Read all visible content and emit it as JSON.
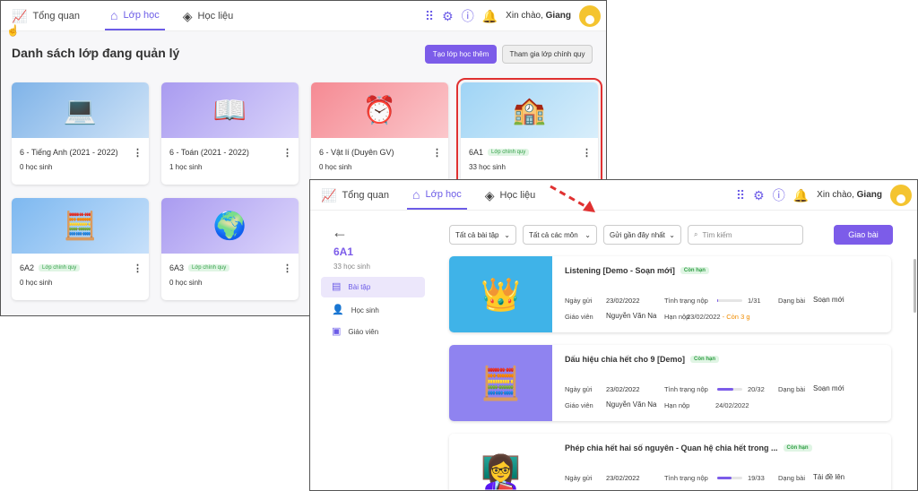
{
  "win1": {
    "nav": {
      "tabs": [
        "Tổng quan",
        "Lớp học",
        "Học liệu"
      ],
      "greeting": "Xin chào,",
      "user": "Giang"
    },
    "heading": "Danh sách lớp đang quản lý",
    "btn_create": "Tạo lớp học thêm",
    "btn_join": "Tham gia lớp chính quy",
    "classes": [
      {
        "title": "6 - Tiếng Anh (2021 - 2022)",
        "students": "0 học sinh",
        "badge": "",
        "icon": "classroom-online-icon"
      },
      {
        "title": "6 - Toán (2021 - 2022)",
        "students": "1 học sinh",
        "badge": "",
        "icon": "laptop-book-icon"
      },
      {
        "title": "6 - Vật lí (Duyên GV)",
        "students": "0 học sinh",
        "badge": "",
        "icon": "alarm-clock-icon"
      },
      {
        "title": "6A1",
        "students": "33 học sinh",
        "badge": "Lớp chính quy",
        "icon": "classroom-board-icon"
      },
      {
        "title": "6A2",
        "students": "0 học sinh",
        "badge": "Lớp chính quy",
        "icon": "calculator-icon"
      },
      {
        "title": "6A3",
        "students": "0 học sinh",
        "badge": "Lớp chính quy",
        "icon": "globe-books-icon"
      }
    ]
  },
  "win2": {
    "nav": {
      "tabs": [
        "Tổng quan",
        "Lớp học",
        "Học liệu"
      ],
      "greeting": "Xin chào,",
      "user": "Giang"
    },
    "class_name": "6A1",
    "class_count": "33 học sinh",
    "side": [
      "Bài tập",
      "Học sinh",
      "Giáo viên"
    ],
    "filters": [
      "Tất cả bài tập",
      "Tất cả các môn",
      "Gửi gần đây nhất"
    ],
    "search_placeholder": "Tìm kiếm",
    "assign_btn": "Giao bài",
    "labels": {
      "sent": "Ngày gửi",
      "teacher": "Giáo viên",
      "status": "Tình trạng nộp",
      "due": "Hạn nộp",
      "type": "Dạng bài"
    },
    "assignments": [
      {
        "title": "Listening [Demo - Soạn mới]",
        "badge": "Còn hạn",
        "sent": "23/02/2022",
        "teacher": "Nguyễn Văn Na",
        "submitted": "1/31",
        "progress": 0.03,
        "due": "23/02/2022",
        "due_note": "- Còn 3 g",
        "type": "Soạn mới"
      },
      {
        "title": "Dấu hiệu chia hết cho 9 [Demo]",
        "badge": "Còn hạn",
        "sent": "23/02/2022",
        "teacher": "Nguyễn Văn Na",
        "submitted": "20/32",
        "progress": 0.63,
        "due": "24/02/2022",
        "due_note": "",
        "type": "Soạn mới"
      },
      {
        "title": "Phép chia hết hai số nguyên - Quan hệ chia hết trong ...",
        "badge": "Còn hạn",
        "sent": "23/02/2022",
        "teacher": "",
        "submitted": "19/33",
        "progress": 0.58,
        "due": "",
        "due_note": "",
        "type": "Tải đề lên"
      }
    ]
  },
  "colors": {
    "accent": "#7c5ce9",
    "highlight": "#e03131",
    "badge": "#2f9e44"
  }
}
